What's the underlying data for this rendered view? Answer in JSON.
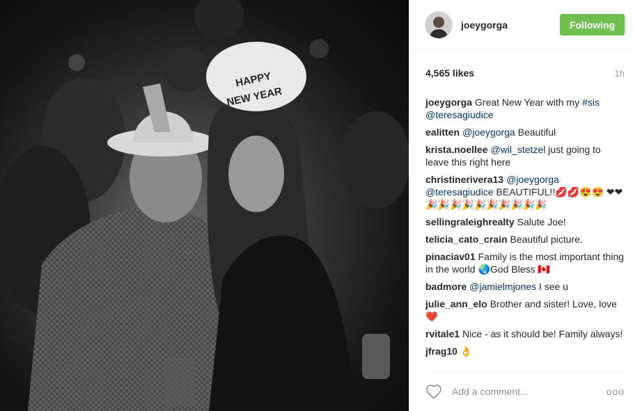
{
  "post": {
    "username": "joeygorga",
    "follow_label": "Following",
    "likes": "4,565 likes",
    "time": "1h"
  },
  "photo": {
    "hat_text_line1": "HAPPY",
    "hat_text_line2": "NEW YEAR"
  },
  "comments": [
    {
      "user": "joeygorga",
      "parts": [
        {
          "t": "Great New Year with my "
        },
        {
          "t": "#sis",
          "m": true
        },
        {
          "t": " "
        },
        {
          "t": "@teresagiudice",
          "m": true
        }
      ]
    },
    {
      "user": "ealitten",
      "parts": [
        {
          "t": "@joeygorga",
          "m": true
        },
        {
          "t": " Beautiful"
        }
      ]
    },
    {
      "user": "krista.noellee",
      "parts": [
        {
          "t": "@wil_stetzel",
          "m": true
        },
        {
          "t": " just going to leave this right here"
        }
      ]
    },
    {
      "user": "christinerivera13",
      "parts": [
        {
          "t": "@joeygorga",
          "m": true
        },
        {
          "t": " "
        },
        {
          "t": "@teresagiudice",
          "m": true
        },
        {
          "t": " BEAUTIFUL!!💋💋😍😍 ❤❤🎉🎉🎉🎉🎉🎉🎉🎉🎉🎉"
        }
      ]
    },
    {
      "user": "sellingraleighrealty",
      "parts": [
        {
          "t": "Salute Joe!"
        }
      ]
    },
    {
      "user": "telicia_cato_crain",
      "parts": [
        {
          "t": "Beautiful picture."
        }
      ]
    },
    {
      "user": "pinaciav01",
      "parts": [
        {
          "t": "Family is the most important thing in the world 🌏God Bless 🇨🇦"
        }
      ]
    },
    {
      "user": "badmore",
      "parts": [
        {
          "t": "@jamielmjones",
          "m": true
        },
        {
          "t": " I see u"
        }
      ]
    },
    {
      "user": "julie_ann_elo",
      "parts": [
        {
          "t": "Brother and sister! Love, love ❤️"
        }
      ]
    },
    {
      "user": "rvitale1",
      "parts": [
        {
          "t": "Nice - as it should be! Family always!"
        }
      ]
    },
    {
      "user": "jfrag10",
      "parts": [
        {
          "t": "👌"
        }
      ]
    }
  ],
  "add_comment": {
    "placeholder": "Add a comment...",
    "more_label": "ooo"
  },
  "icons": {
    "heart": "heart-outline-icon",
    "more": "more-options-icon"
  },
  "colors": {
    "follow_button": "#70c050",
    "mention": "#003569"
  }
}
